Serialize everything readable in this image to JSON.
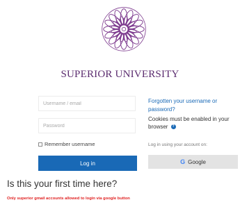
{
  "branding": {
    "university_name": "SUPERIOR UNIVERSITY",
    "logo_icon": "mandala-flower-logo",
    "brand_color": "#5b2c6f"
  },
  "form": {
    "username_placeholder": "Username / email",
    "password_placeholder": "Password",
    "remember_label": "Remember username",
    "login_label": "Log in",
    "button_color": "#1969b6"
  },
  "side": {
    "forgot_link": "Forgotten your username or password?",
    "cookies_text": "Cookies must be enabled in your browser",
    "help_icon": "question-help-icon",
    "account_prompt": "Log in using your account on:",
    "google_label": "Google",
    "google_icon": "google-g-icon"
  },
  "footer": {
    "first_time": "Is this your first time here?",
    "notice": "Only superior gmail accounts allowed to login via google button",
    "notice_color": "#e02020"
  }
}
